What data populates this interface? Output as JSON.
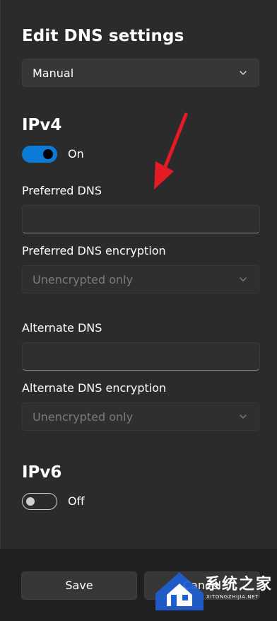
{
  "dialog": {
    "title": "Edit DNS settings",
    "mode_select": "Manual"
  },
  "ipv4": {
    "heading": "IPv4",
    "toggle_state": "On",
    "preferred_dns_label": "Preferred DNS",
    "preferred_dns_value": "",
    "preferred_encryption_label": "Preferred DNS encryption",
    "preferred_encryption_value": "Unencrypted only",
    "alternate_dns_label": "Alternate DNS",
    "alternate_dns_value": "",
    "alternate_encryption_label": "Alternate DNS encryption",
    "alternate_encryption_value": "Unencrypted only"
  },
  "ipv6": {
    "heading": "IPv6",
    "toggle_state": "Off"
  },
  "footer": {
    "save_label": "Save",
    "cancel_label": "Cancel"
  },
  "watermark": {
    "name": "系统之家",
    "url": "XITONGZHIJIA.NET"
  },
  "colors": {
    "panel_bg": "#2b2b2b",
    "accent": "#0c7bd8",
    "arrow": "#e21b24"
  }
}
